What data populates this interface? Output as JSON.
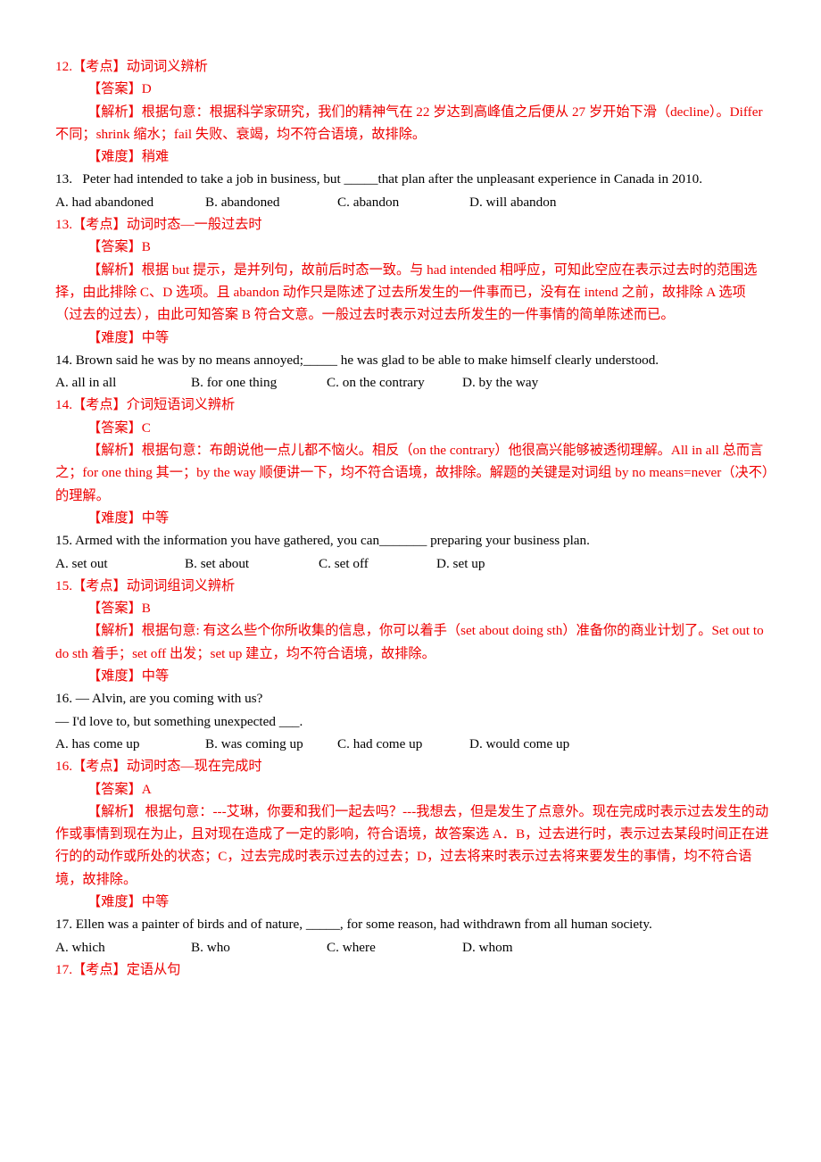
{
  "document": {
    "type": "english-exam-answer-key",
    "language": "zh-CN",
    "text_color_body": "#000000",
    "text_color_analysis": "#ee0000"
  },
  "items": [
    {
      "number": "12",
      "kaodian_line": "12.【考点】动词词义辨析",
      "answer_line": "【答案】D",
      "analysis_line": "【解析】根据句意：根据科学家研究，我们的精神气在 22 岁达到高峰值之后便从 27 岁开始下滑（decline）。Differ 不同；shrink 缩水；fail 失败、衰竭，均不符合语境，故排除。",
      "difficulty_line": "【难度】稍难"
    },
    {
      "number": "13",
      "question_line": "13.   Peter had intended to take a job in business, but _____that plan after the unpleasant experience in Canada in 2010.",
      "options": [
        "A. had abandoned",
        "B. abandoned",
        "C. abandon",
        "D. will abandon"
      ],
      "kaodian_line": "13.【考点】动词时态—一般过去时",
      "answer_line": "【答案】B",
      "analysis_line": "【解析】根据 but 提示，是并列句，故前后时态一致。与 had intended 相呼应，可知此空应在表示过去时的范围选择，由此排除 C、D 选项。且 abandon 动作只是陈述了过去所发生的一件事而已，没有在 intend 之前，故排除 A 选项（过去的过去），由此可知答案 B 符合文意。一般过去时表示对过去所发生的一件事情的简单陈述而已。",
      "difficulty_line": "【难度】中等"
    },
    {
      "number": "14",
      "question_line": "14. Brown said he was by no means annoyed;_____ he was glad to be able to make himself clearly understood.",
      "options": [
        "A. all in all",
        "B. for one thing",
        "C. on the contrary",
        "D. by the way"
      ],
      "kaodian_line": "14.【考点】介词短语词义辨析",
      "answer_line": "【答案】C",
      "analysis_line": "【解析】根据句意：布朗说他一点儿都不恼火。相反（on the contrary）他很高兴能够被透彻理解。All in all 总而言之；for one thing 其一；by the way 顺便讲一下，均不符合语境，故排除。解题的关键是对词组 by no means=never（决不）的理解。",
      "difficulty_line": "【难度】中等"
    },
    {
      "number": "15",
      "question_line": "15. Armed with the information you have gathered, you can_______ preparing your business plan.",
      "options": [
        "A. set out",
        "B. set about",
        "C. set off",
        "D. set up"
      ],
      "kaodian_line": "15.【考点】动词词组词义辨析",
      "answer_line": "【答案】B",
      "analysis_line": "【解析】根据句意: 有这么些个你所收集的信息，你可以着手（set about doing sth）准备你的商业计划了。Set out to do sth 着手；set off 出发；set up 建立，均不符合语境，故排除。",
      "difficulty_line": "【难度】中等"
    },
    {
      "number": "16",
      "question_line_1": "16. — Alvin, are you coming with us?",
      "question_line_2": "— I'd love to, but something unexpected ___.",
      "options": [
        "A. has come up",
        "B. was coming up",
        "C. had come up",
        "D. would come up"
      ],
      "kaodian_line": "16.【考点】动词时态—现在完成时",
      "answer_line": "【答案】A",
      "analysis_line": "【解析】 根据句意：---艾琳，你要和我们一起去吗？---我想去，但是发生了点意外。现在完成时表示过去发生的动作或事情到现在为止，且对现在造成了一定的影响，符合语境，故答案选 A．B，过去进行时，表示过去某段时间正在进行的的动作或所处的状态；C，过去完成时表示过去的过去；D，过去将来时表示过去将来要发生的事情，均不符合语境，故排除。",
      "difficulty_line": "【难度】中等"
    },
    {
      "number": "17",
      "question_line": "17. Ellen was a painter of birds and of nature, _____, for some reason, had withdrawn from all human society.",
      "options": [
        "A. which",
        "B. who",
        "C. where",
        "D. whom"
      ],
      "kaodian_line": "17.【考点】定语从句"
    }
  ]
}
